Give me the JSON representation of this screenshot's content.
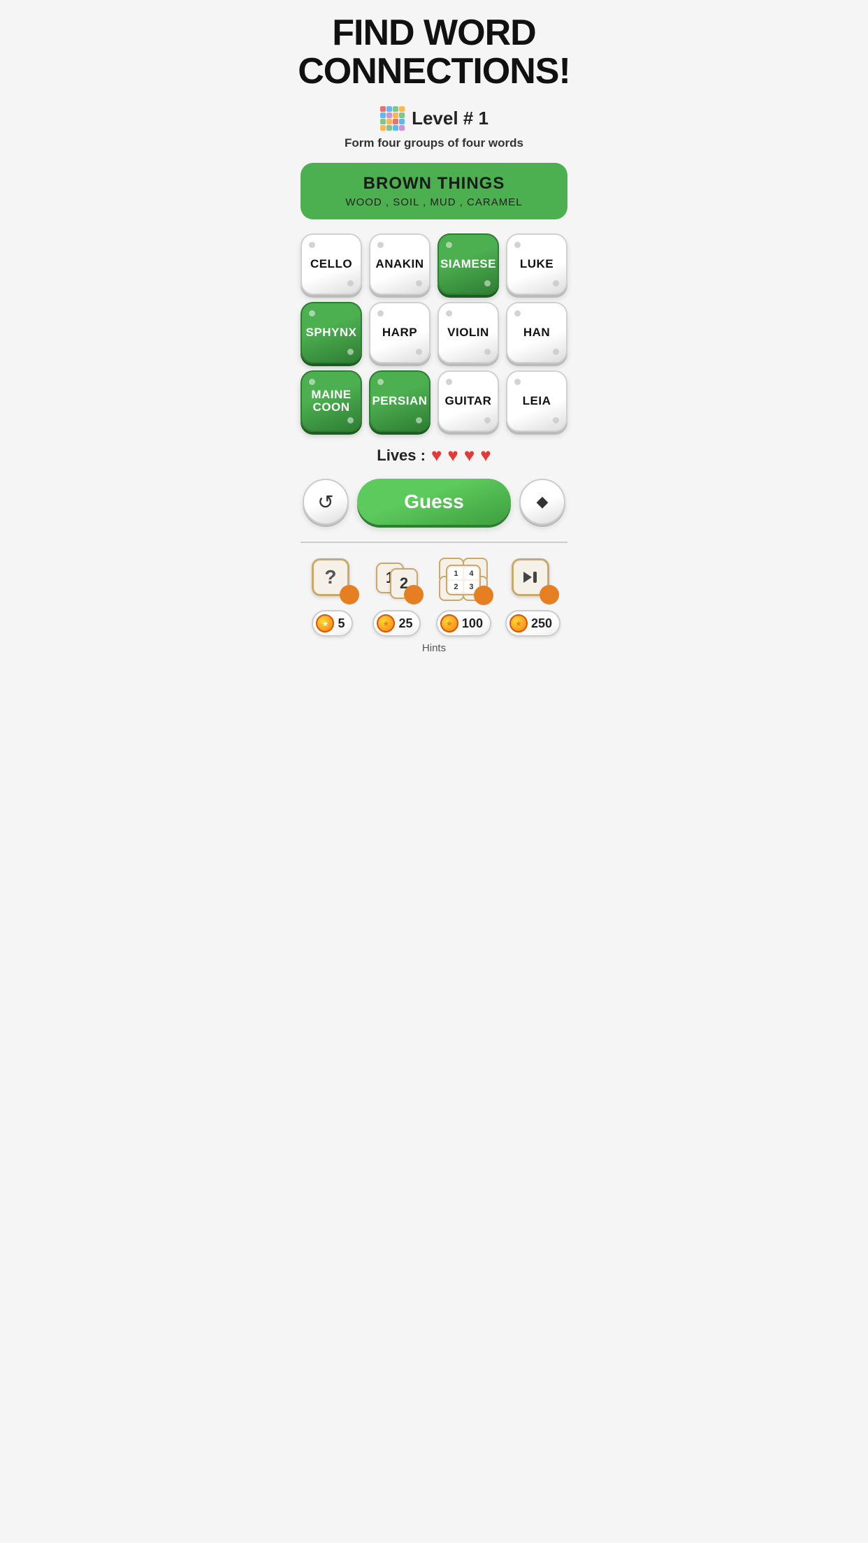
{
  "title": "FIND WORD CONNECTIONS!",
  "level": {
    "label": "Level # 1",
    "icon": "grid-icon"
  },
  "subtitle": "Form four groups of four words",
  "found_group": {
    "title": "BROWN THINGS",
    "words": "WOOD , SOIL , MUD , CARAMEL"
  },
  "tiles": [
    {
      "id": 0,
      "word": "CELLO",
      "selected": false
    },
    {
      "id": 1,
      "word": "ANAKIN",
      "selected": false
    },
    {
      "id": 2,
      "word": "SIAMESE",
      "selected": true
    },
    {
      "id": 3,
      "word": "LUKE",
      "selected": false
    },
    {
      "id": 4,
      "word": "SPHYNX",
      "selected": true
    },
    {
      "id": 5,
      "word": "HARP",
      "selected": false
    },
    {
      "id": 6,
      "word": "VIOLIN",
      "selected": false
    },
    {
      "id": 7,
      "word": "HAN",
      "selected": false
    },
    {
      "id": 8,
      "word": "MAINE\nCOON",
      "selected": true
    },
    {
      "id": 9,
      "word": "PERSIAN",
      "selected": true
    },
    {
      "id": 10,
      "word": "GUITAR",
      "selected": false
    },
    {
      "id": 11,
      "word": "LEIA",
      "selected": false
    }
  ],
  "lives": {
    "label": "Lives :",
    "count": 4
  },
  "controls": {
    "shuffle_label": "↺",
    "guess_label": "Guess",
    "erase_label": "◆"
  },
  "hints": [
    {
      "id": "hint-reveal",
      "icon_type": "question",
      "cost": "5"
    },
    {
      "id": "hint-swap",
      "icon_type": "swap",
      "cost": "25"
    },
    {
      "id": "hint-multi",
      "icon_type": "multi",
      "cost": "100"
    },
    {
      "id": "hint-skip",
      "icon_type": "skip",
      "cost": "250"
    }
  ],
  "hints_label": "Hints",
  "colors": {
    "green": "#4caf50",
    "dark_green": "#2e7d32",
    "red_heart": "#e53935",
    "orange": "#e67e22"
  }
}
